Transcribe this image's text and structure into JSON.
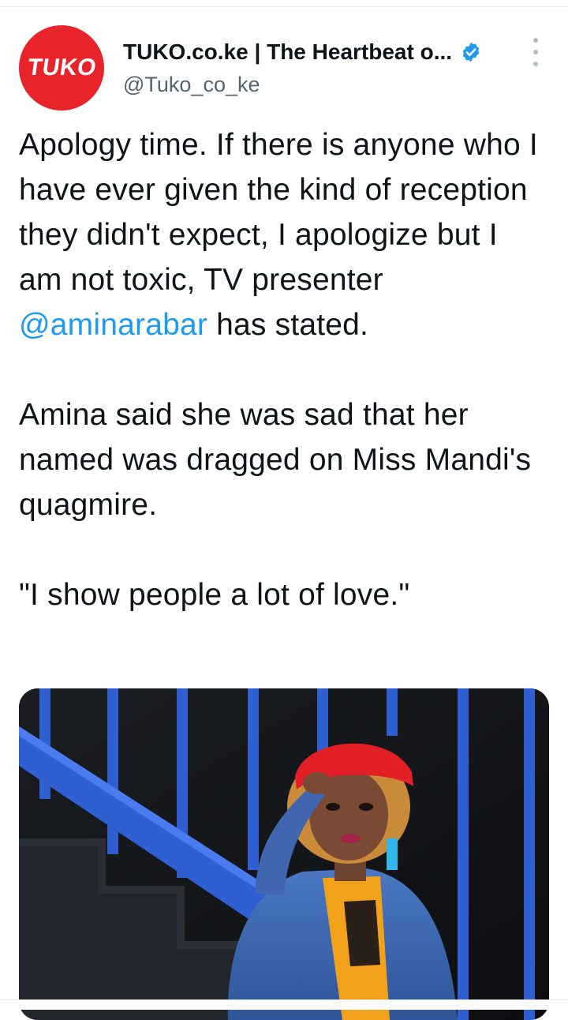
{
  "tweet": {
    "avatar_text": "TUKO",
    "display_name": "TUKO.co.ke | The Heartbeat o...",
    "handle": "@Tuko_co_ke",
    "verified_icon": "verified-badge-icon",
    "more_icon": "more-vertical-icon",
    "paragraph1_before": "Apology time. If there is anyone who I have ever given the kind of reception they didn't expect, I apologize but I am not toxic,  TV presenter ",
    "mention": "@aminarabar",
    "paragraph1_after": " has stated.",
    "paragraph2": "Amina said she was sad that her named was dragged on Miss Mandi's quagmire.",
    "paragraph3": "\"I show people a lot of love.\""
  },
  "colors": {
    "brand_red": "#e8232a",
    "link_blue": "#1d9bf0",
    "verified_blue": "#1d9bf0"
  }
}
